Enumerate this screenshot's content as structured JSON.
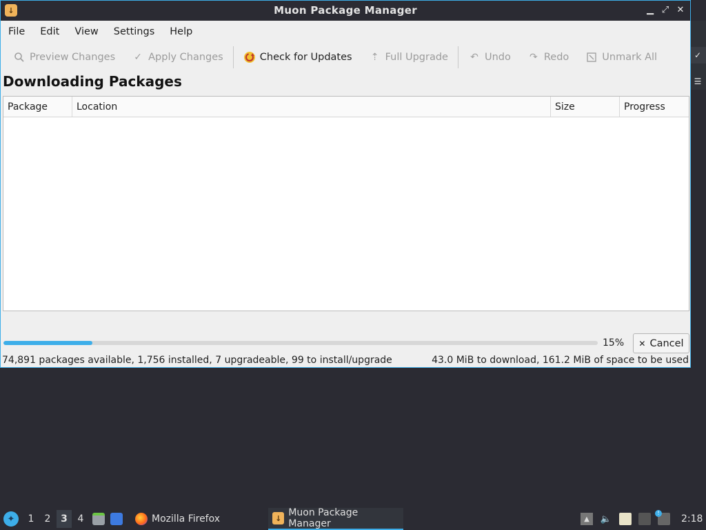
{
  "window": {
    "title": "Muon Package Manager",
    "controls": [
      "minimize",
      "maximize",
      "close"
    ]
  },
  "menu": [
    "File",
    "Edit",
    "View",
    "Settings",
    "Help"
  ],
  "toolbar": {
    "preview": "Preview Changes",
    "apply": "Apply Changes",
    "check": "Check for Updates",
    "full_upgrade": "Full Upgrade",
    "undo": "Undo",
    "redo": "Redo",
    "unmark": "Unmark All"
  },
  "main": {
    "heading": "Downloading Packages",
    "columns": [
      "Package",
      "Location",
      "Size",
      "Progress"
    ]
  },
  "progress": {
    "value": 0.15,
    "label": "15%",
    "cancel": "Cancel"
  },
  "status": {
    "left": "74,891 packages available, 1,756 installed, 7 upgradeable, 99 to install/upgrade",
    "right": "43.0 MiB to download, 161.2 MiB of space to be used"
  },
  "taskbar": {
    "workspaces": [
      "1",
      "2",
      "3",
      "4"
    ],
    "active_workspace": "3",
    "tasks": [
      "Mozilla Firefox",
      "Muon Package Manager"
    ],
    "clock": "2:18"
  },
  "colors": {
    "accent": "#3daee9",
    "titlebar": "#2b2b33",
    "window_bg": "#efefef"
  }
}
